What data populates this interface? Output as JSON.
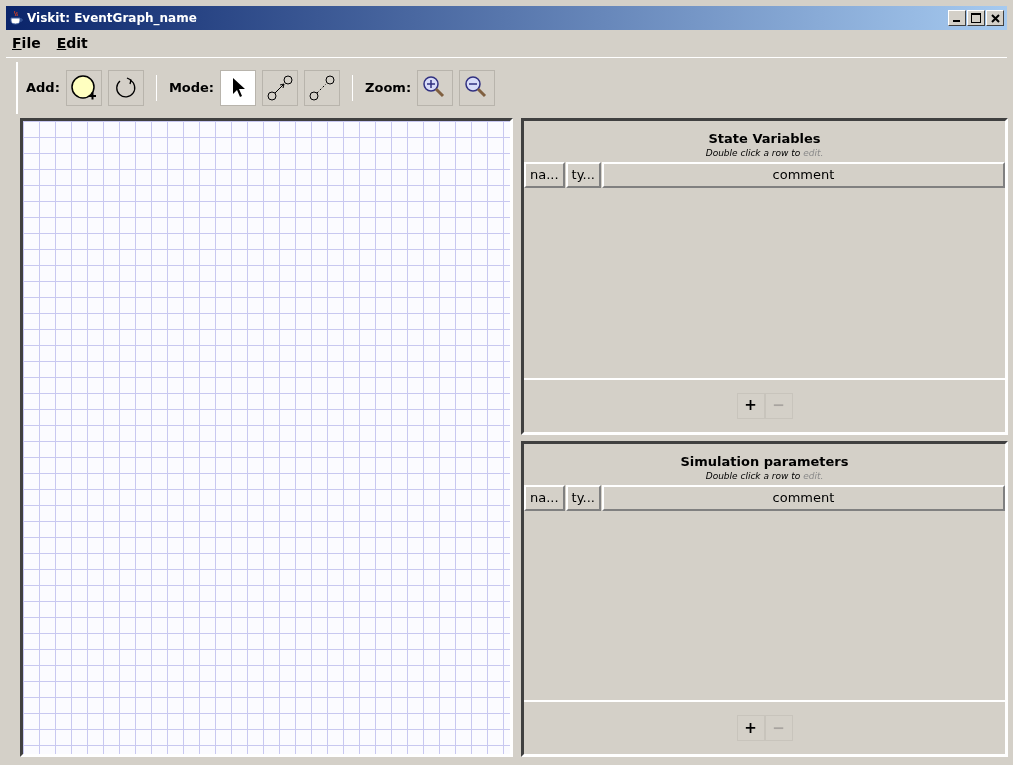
{
  "window": {
    "title": "Viskit: EventGraph_name"
  },
  "menu": [
    {
      "label": "File"
    },
    {
      "label": "Edit"
    }
  ],
  "toolbar": [
    {
      "label": "Add:",
      "tools": [
        {
          "kind": "node"
        },
        {
          "kind": "loop"
        }
      ]
    },
    {
      "label": "Mode:",
      "tools": [
        {
          "kind": "select",
          "selected": true
        },
        {
          "kind": "arc",
          "selected": false
        },
        {
          "kind": "cancel-arc",
          "selected": false
        }
      ]
    },
    {
      "label": "Zoom:",
      "tools": [
        {
          "kind": "zoom-in"
        },
        {
          "kind": "zoom-out"
        }
      ]
    }
  ],
  "panels": [
    {
      "title": "State Variables",
      "hint": "Double click a row to",
      "hint_action": "edit.",
      "columns": [
        "na...",
        "ty...",
        "comment"
      ],
      "buttons": [
        {
          "label": "+",
          "disabled": false
        },
        {
          "label": "−",
          "disabled": true
        }
      ]
    },
    {
      "title": "Simulation parameters",
      "hint": "Double click a row to",
      "hint_action": "edit.",
      "columns": [
        "na...",
        "ty...",
        "comment"
      ],
      "buttons": [
        {
          "label": "+",
          "disabled": false
        },
        {
          "label": "−",
          "disabled": true
        }
      ]
    }
  ]
}
